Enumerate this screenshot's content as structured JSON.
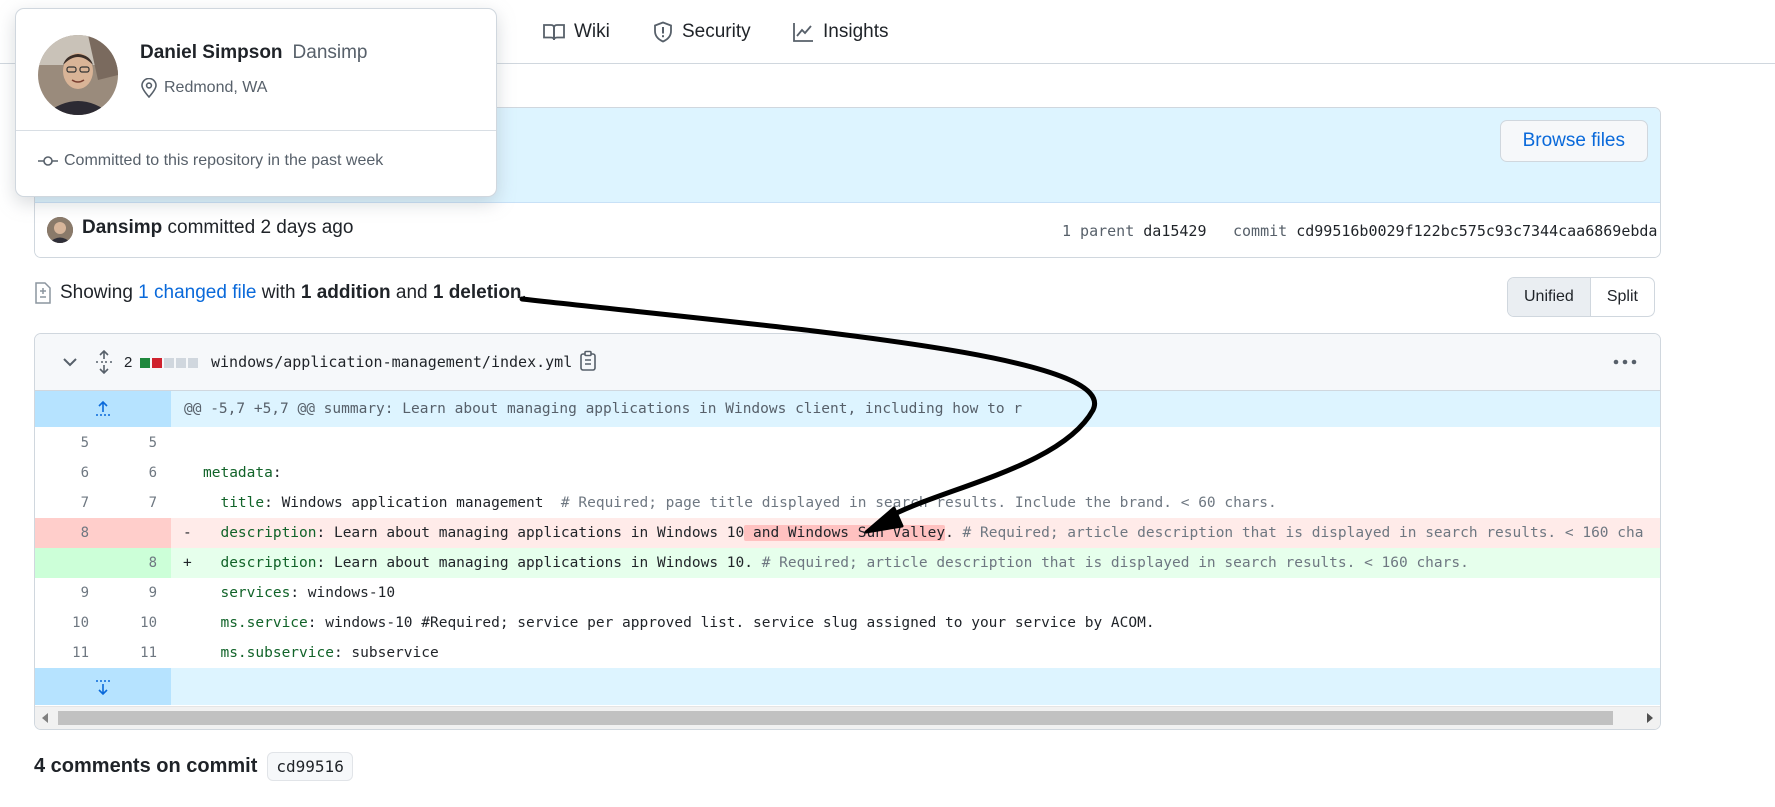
{
  "nav": {
    "items": [
      {
        "label": "s"
      },
      {
        "label": "Wiki"
      },
      {
        "label": "Security"
      },
      {
        "label": "Insights"
      }
    ]
  },
  "hovercard": {
    "name": "Daniel Simpson",
    "login": "Dansimp",
    "location": "Redmond, WA",
    "footer": "Committed to this repository in the past week"
  },
  "commit": {
    "browse_label": "Browse files",
    "author": "Dansimp",
    "committed_text": "committed 2 days ago",
    "parent_label": "1 parent",
    "parent_sha": "da15429",
    "commit_label": "commit",
    "commit_sha": "cd99516b0029f122bc575c93c7344caa6869ebda"
  },
  "summary": {
    "showing": "Showing",
    "changed_files": "1 changed file",
    "with": "with",
    "additions": "1 addition",
    "and": "and",
    "deletions": "1 deletion",
    "period": "."
  },
  "view_toggle": {
    "unified": "Unified",
    "split": "Split",
    "selected": "Unified"
  },
  "file": {
    "change_count": "2",
    "path": "windows/application-management/index.yml",
    "stat_colors": [
      "#1f883d",
      "#cf222e",
      "#d0d7de",
      "#d0d7de",
      "#d0d7de"
    ],
    "hunk_header": "@@ -5,7 +5,7 @@ summary: Learn about managing applications in Windows client, including how to r",
    "rows": [
      {
        "old": "5",
        "new": "5",
        "type": "ctx",
        "key": "",
        "val": ""
      },
      {
        "old": "6",
        "new": "6",
        "type": "ctx",
        "key": "metadata",
        "val": ":"
      },
      {
        "old": "7",
        "new": "7",
        "type": "ctx",
        "key": "  title",
        "val": ": Windows application management  ",
        "comment": "# Required; page title displayed in search results. Include the brand. < 60 chars."
      },
      {
        "old": "8",
        "new": "",
        "type": "del",
        "sign": "-",
        "key": "  description",
        "pre": ": Learn about managing applications in Windows 10",
        "hl": " and Windows Sun Valley",
        "post": ". ",
        "comment": "# Required; article description that is displayed in search results. < 160 cha"
      },
      {
        "old": "",
        "new": "8",
        "type": "add",
        "sign": "+",
        "key": "  description",
        "pre": ": Learn about managing applications in Windows 10. ",
        "comment": "# Required; article description that is displayed in search results. < 160 chars."
      },
      {
        "old": "9",
        "new": "9",
        "type": "ctx",
        "key": "  services",
        "val": ": windows-10"
      },
      {
        "old": "10",
        "new": "10",
        "type": "ctx",
        "key": "  ms.service",
        "val": ": windows-10 #Required; service per approved list. service slug assigned to your service by ACOM."
      },
      {
        "old": "11",
        "new": "11",
        "type": "ctx",
        "key": "  ms.subservice",
        "val": ": subservice"
      }
    ]
  },
  "comments": {
    "title": "4 comments on commit",
    "sha": "cd99516"
  },
  "colors": {
    "link": "#0969da",
    "del_bg": "#ffebe9",
    "add_bg": "#e6ffec",
    "hunk_bg": "#ddf4ff",
    "annotation_arrow": "#000000"
  }
}
